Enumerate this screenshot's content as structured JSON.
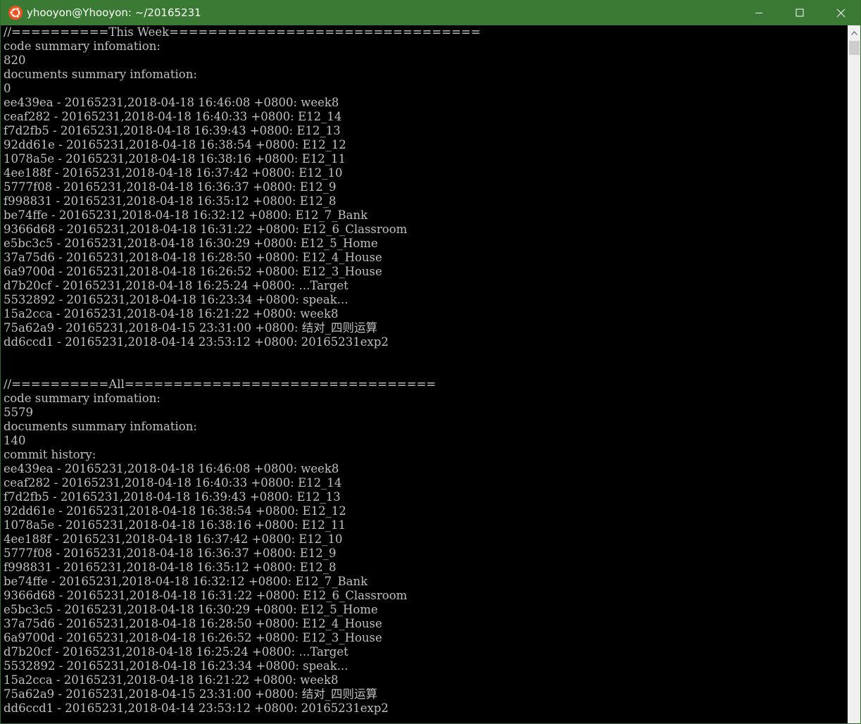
{
  "window": {
    "title": "yhooyon@Yhooyon: ~/20165231"
  },
  "icons": {
    "app": "ubuntu-logo-icon",
    "minimize": "minimize-icon",
    "maximize": "maximize-icon",
    "close": "close-icon",
    "scroll_up": "scroll-up-arrow-icon"
  },
  "colors": {
    "titlebar": "#3a7a34",
    "terminal_bg": "#000000",
    "terminal_fg": "#c0c0c0",
    "ubuntu": "#e95420"
  },
  "terminal": {
    "lines": [
      "//==========This Week================================",
      "code summary infomation:",
      "820",
      "documents summary infomation:",
      "0",
      "ee439ea - 20165231,2018-04-18 16:46:08 +0800: week8",
      "ceaf282 - 20165231,2018-04-18 16:40:33 +0800: E12_14",
      "f7d2fb5 - 20165231,2018-04-18 16:39:43 +0800: E12_13",
      "92dd61e - 20165231,2018-04-18 16:38:54 +0800: E12_12",
      "1078a5e - 20165231,2018-04-18 16:38:16 +0800: E12_11",
      "4ee188f - 20165231,2018-04-18 16:37:42 +0800: E12_10",
      "5777f08 - 20165231,2018-04-18 16:36:37 +0800: E12_9",
      "f998831 - 20165231,2018-04-18 16:35:12 +0800: E12_8",
      "be74ffe - 20165231,2018-04-18 16:32:12 +0800: E12_7_Bank",
      "9366d68 - 20165231,2018-04-18 16:31:22 +0800: E12_6_Classroom",
      "e5bc3c5 - 20165231,2018-04-18 16:30:29 +0800: E12_5_Home",
      "37a75d6 - 20165231,2018-04-18 16:28:50 +0800: E12_4_House",
      "6a9700d - 20165231,2018-04-18 16:26:52 +0800: E12_3_House",
      "d7b20cf - 20165231,2018-04-18 16:25:24 +0800: ...Target",
      "5532892 - 20165231,2018-04-18 16:23:34 +0800: speak...",
      "15a2cca - 20165231,2018-04-18 16:21:22 +0800: week8",
      "75a62a9 - 20165231,2018-04-15 23:31:00 +0800: 结对_四则运算",
      "dd6ccd1 - 20165231,2018-04-14 23:53:12 +0800: 20165231exp2",
      "",
      "",
      "//==========All================================",
      "code summary infomation:",
      "5579",
      "documents summary infomation:",
      "140",
      "commit history:",
      "ee439ea - 20165231,2018-04-18 16:46:08 +0800: week8",
      "ceaf282 - 20165231,2018-04-18 16:40:33 +0800: E12_14",
      "f7d2fb5 - 20165231,2018-04-18 16:39:43 +0800: E12_13",
      "92dd61e - 20165231,2018-04-18 16:38:54 +0800: E12_12",
      "1078a5e - 20165231,2018-04-18 16:38:16 +0800: E12_11",
      "4ee188f - 20165231,2018-04-18 16:37:42 +0800: E12_10",
      "5777f08 - 20165231,2018-04-18 16:36:37 +0800: E12_9",
      "f998831 - 20165231,2018-04-18 16:35:12 +0800: E12_8",
      "be74ffe - 20165231,2018-04-18 16:32:12 +0800: E12_7_Bank",
      "9366d68 - 20165231,2018-04-18 16:31:22 +0800: E12_6_Classroom",
      "e5bc3c5 - 20165231,2018-04-18 16:30:29 +0800: E12_5_Home",
      "37a75d6 - 20165231,2018-04-18 16:28:50 +0800: E12_4_House",
      "6a9700d - 20165231,2018-04-18 16:26:52 +0800: E12_3_House",
      "d7b20cf - 20165231,2018-04-18 16:25:24 +0800: ...Target",
      "5532892 - 20165231,2018-04-18 16:23:34 +0800: speak...",
      "15a2cca - 20165231,2018-04-18 16:21:22 +0800: week8",
      "75a62a9 - 20165231,2018-04-15 23:31:00 +0800: 结对_四则运算",
      "dd6ccd1 - 20165231,2018-04-14 23:53:12 +0800: 20165231exp2"
    ]
  }
}
